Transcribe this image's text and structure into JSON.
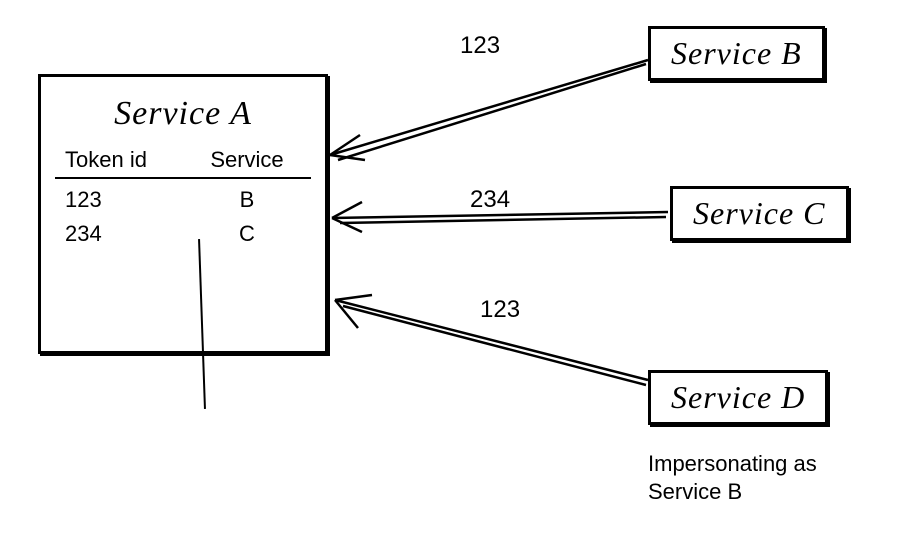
{
  "serviceA": {
    "title": "Service A",
    "columns": {
      "tokenId": "Token id",
      "service": "Service"
    },
    "rows": [
      {
        "tokenId": "123",
        "service": "B"
      },
      {
        "tokenId": "234",
        "service": "C"
      }
    ]
  },
  "remotes": {
    "b": {
      "label": "Service B",
      "token": "123"
    },
    "c": {
      "label": "Service C",
      "token": "234"
    },
    "d": {
      "label": "Service D",
      "token": "123",
      "note": "Impersonating as Service B"
    }
  }
}
